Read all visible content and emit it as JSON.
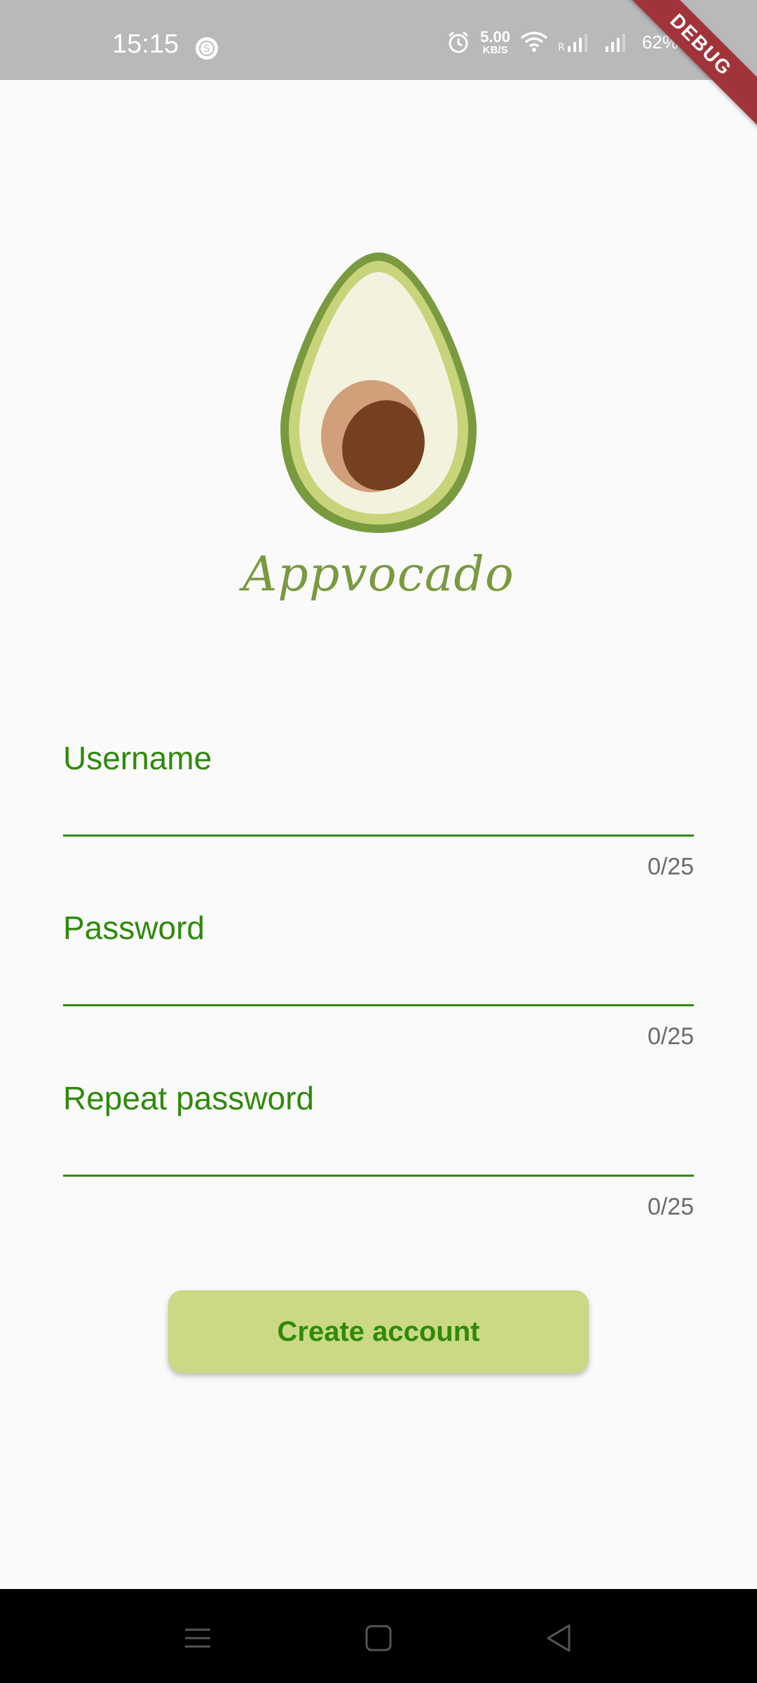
{
  "status_bar": {
    "time": "15:15",
    "app_icon": "s-circle-icon",
    "net_speed_value": "5.00",
    "net_speed_unit": "KB/S",
    "battery": "62%",
    "icons": [
      "alarm-icon",
      "wifi-icon",
      "signal-r-icon",
      "signal-icon",
      "battery-charging-icon"
    ]
  },
  "debug_banner": "DEBUG",
  "app": {
    "name": "Appvocado",
    "logo": "avocado-logo"
  },
  "form": {
    "fields": [
      {
        "label": "Username",
        "value": "",
        "counter": "0/25"
      },
      {
        "label": "Password",
        "value": "",
        "counter": "0/25"
      },
      {
        "label": "Repeat password",
        "value": "",
        "counter": "0/25"
      }
    ],
    "submit_label": "Create account"
  },
  "nav_bar": {
    "buttons": [
      "menu-icon",
      "home-icon",
      "back-icon"
    ]
  },
  "colors": {
    "accent": "#2f8a0a",
    "button_bg": "#cbd884",
    "logo_green": "#7a9a3f",
    "status_bar": "#b9b9b9",
    "background": "#fafafa"
  }
}
